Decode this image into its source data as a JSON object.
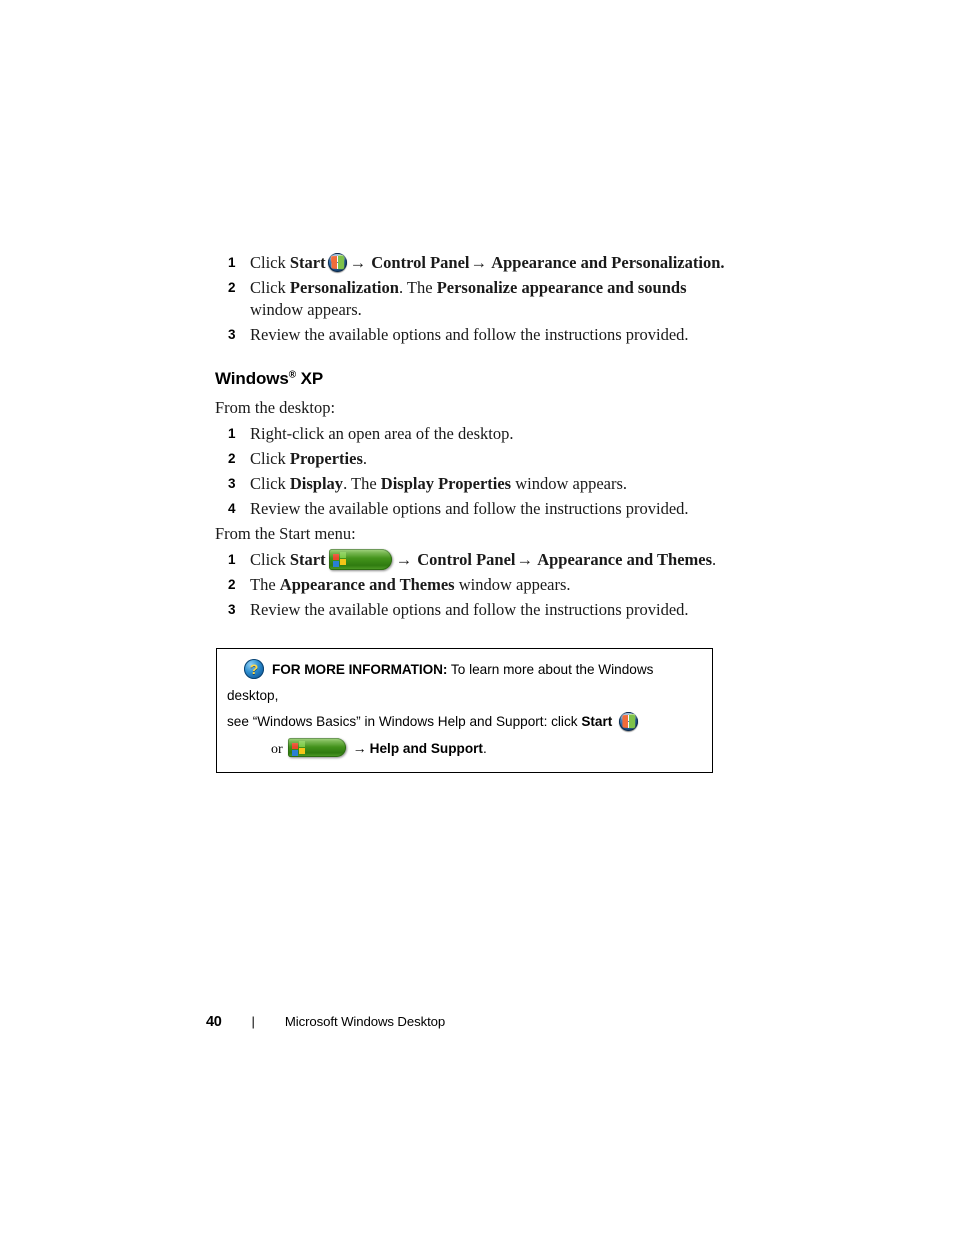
{
  "document": {
    "page_number": "40",
    "footer_separator": "|",
    "footer_title": "Microsoft Windows Desktop"
  },
  "vista_section": {
    "steps": [
      {
        "num": "1",
        "parts": [
          {
            "t": "Click ",
            "style": "normal"
          },
          {
            "t": "Start",
            "style": "bold"
          },
          {
            "t": "vista-orb",
            "style": "icon"
          },
          {
            "t": "→",
            "style": "arrow"
          },
          {
            "t": " Control Panel",
            "style": "bold"
          },
          {
            "t": "→",
            "style": "arrow"
          },
          {
            "t": " Appearance and Personalization.",
            "style": "bold"
          }
        ]
      },
      {
        "num": "2",
        "parts": [
          {
            "t": "Click ",
            "style": "normal"
          },
          {
            "t": "Personalization",
            "style": "bold"
          },
          {
            "t": ". The ",
            "style": "normal"
          },
          {
            "t": "Personalize appearance and sounds",
            "style": "bold"
          },
          {
            "t": " window appears.",
            "style": "normal"
          }
        ]
      },
      {
        "num": "3",
        "parts": [
          {
            "t": "Review the available options and follow the instructions provided.",
            "style": "normal"
          }
        ]
      }
    ]
  },
  "xp_section": {
    "heading_main": "Windows",
    "heading_sup": "®",
    "heading_tail": " XP",
    "desktop_intro": "From the desktop:",
    "desktop_steps": [
      {
        "num": "1",
        "parts": [
          {
            "t": "Right-click an open area of the desktop.",
            "style": "normal"
          }
        ]
      },
      {
        "num": "2",
        "parts": [
          {
            "t": "Click ",
            "style": "normal"
          },
          {
            "t": "Properties",
            "style": "bold"
          },
          {
            "t": ".",
            "style": "normal"
          }
        ]
      },
      {
        "num": "3",
        "parts": [
          {
            "t": "Click ",
            "style": "normal"
          },
          {
            "t": "Display",
            "style": "bold"
          },
          {
            "t": ". The ",
            "style": "normal"
          },
          {
            "t": "Display Properties",
            "style": "bold"
          },
          {
            "t": " window appears.",
            "style": "normal"
          }
        ]
      },
      {
        "num": "4",
        "parts": [
          {
            "t": "Review the available options and follow the instructions provided.",
            "style": "normal"
          }
        ]
      }
    ],
    "startmenu_intro": "From the Start menu:",
    "startmenu_steps": [
      {
        "num": "1",
        "parts": [
          {
            "t": "Click ",
            "style": "normal"
          },
          {
            "t": "Start",
            "style": "bold"
          },
          {
            "t": "xp-start-button",
            "style": "icon"
          },
          {
            "t": "→",
            "style": "arrow"
          },
          {
            "t": " Control Panel",
            "style": "bold"
          },
          {
            "t": "→",
            "style": "arrow"
          },
          {
            "t": " Appearance and Themes",
            "style": "bold"
          },
          {
            "t": ".",
            "style": "normal"
          }
        ]
      },
      {
        "num": "2",
        "parts": [
          {
            "t": "The ",
            "style": "normal"
          },
          {
            "t": "Appearance and Themes",
            "style": "bold"
          },
          {
            "t": " window appears.",
            "style": "normal"
          }
        ]
      },
      {
        "num": "3",
        "parts": [
          {
            "t": "Review the available options and follow the instructions provided.",
            "style": "normal"
          }
        ]
      }
    ]
  },
  "info_box": {
    "icon_name": "question-mark-icon",
    "icon_glyph": "?",
    "lead_label": "FOR MORE INFORMATION:",
    "line1_text": " To learn more about the Windows desktop,",
    "line2_text": "see “Windows Basics” in Windows Help and Support: click ",
    "line2_bold": "Start",
    "line3_or": "or",
    "line3_arrow": "→",
    "line3_bold": "Help and Support",
    "line3_period": "."
  },
  "colors": {
    "vista_orb_blue": "#12406f",
    "xp_button_green": "#3d8c18",
    "info_icon_blue": "#1666a8",
    "info_icon_yellow": "#ffd94a",
    "text_black": "#1a1a1a",
    "page_background": "#ffffff"
  }
}
